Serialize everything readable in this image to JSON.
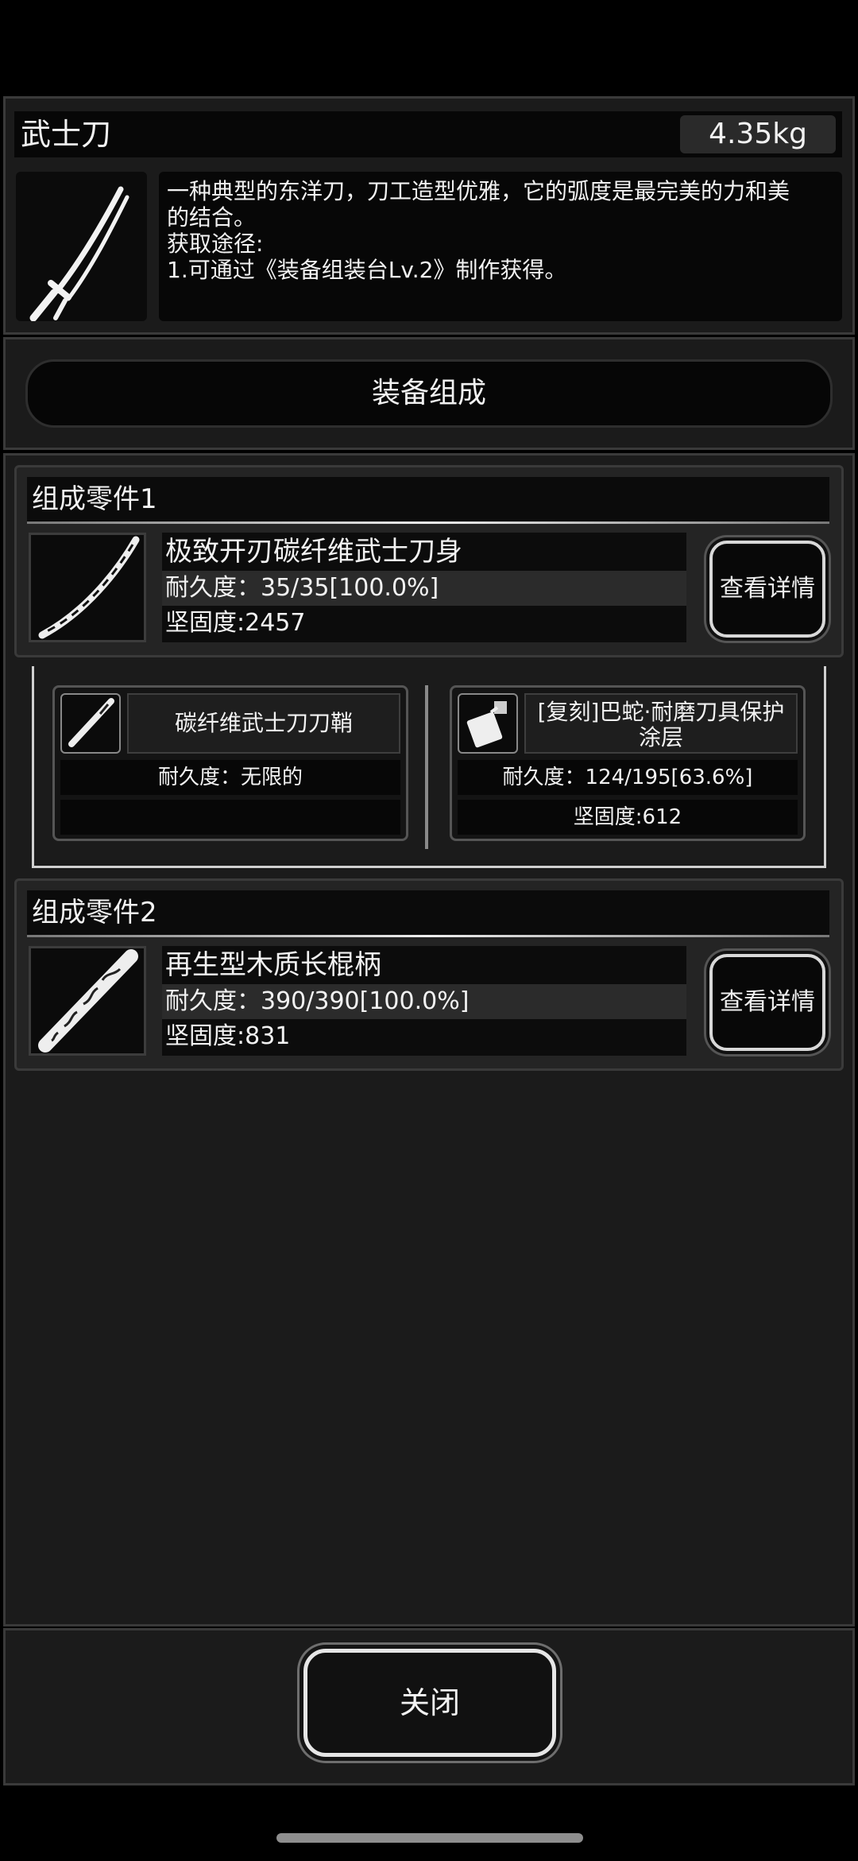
{
  "item": {
    "name": "武士刀",
    "weight": "4.35kg",
    "description_lines": [
      "一种典型的东洋刀，刀工造型优雅，它的弧度是最完美的力和美",
      "的结合。",
      "获取途径:",
      "1.可通过《装备组装台Lv.2》制作获得。"
    ]
  },
  "section_button": "装备组成",
  "parts": [
    {
      "header": "组成零件1",
      "name": "极致开刃碳纤维武士刀身",
      "durability": "耐久度：35/35[100.0%]",
      "hardness": "坚固度:2457",
      "detail_button": "查看详情",
      "icon": "katana-blade-icon"
    },
    {
      "header": "组成零件2",
      "name": "再生型木质长棍柄",
      "durability": "耐久度：390/390[100.0%]",
      "hardness": "坚固度:831",
      "detail_button": "查看详情",
      "icon": "wooden-handle-icon"
    }
  ],
  "sub_components": [
    {
      "name": "碳纤维武士刀刀鞘",
      "durability": "耐久度：无限的",
      "hardness": "",
      "icon": "scabbard-icon"
    },
    {
      "name_line1": "[复刻]巴蛇·耐磨刀具保护",
      "name_line2": "涂层",
      "durability": "耐久度：124/195[63.6%]",
      "hardness": "坚固度:612",
      "icon": "spray-coating-icon"
    }
  ],
  "close_button": "关闭",
  "main_icon": "katana-icon"
}
